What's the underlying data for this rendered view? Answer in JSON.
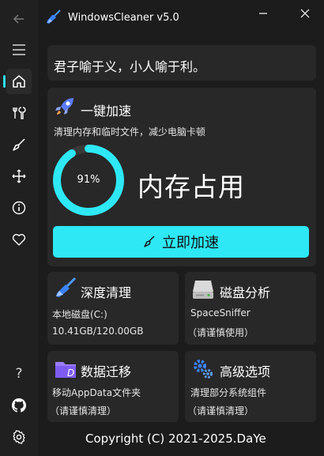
{
  "app": {
    "title": "WindowsCleaner v5.0"
  },
  "sidebar": {
    "items": [
      {
        "name": "back-icon"
      },
      {
        "name": "menu-icon"
      },
      {
        "name": "home-icon",
        "active": true
      },
      {
        "name": "tools-icon"
      },
      {
        "name": "broom-icon"
      },
      {
        "name": "move-icon"
      },
      {
        "name": "info-icon"
      },
      {
        "name": "heart-icon"
      },
      {
        "name": "help-icon",
        "label": "?"
      },
      {
        "name": "github-icon"
      },
      {
        "name": "settings-icon"
      }
    ]
  },
  "quote": {
    "text": "君子喻于义，小人喻于利。"
  },
  "accelerate": {
    "title": "一键加速",
    "subtitle": "清理内存和临时文件，减少电脑卡顿",
    "memory_percent": 91,
    "memory_percent_label": "91%",
    "memory_label": "内存占用",
    "button_label": "立即加速"
  },
  "tiles": {
    "deep_clean": {
      "title": "深度清理",
      "line1": "本地磁盘(C:)",
      "line2": "10.41GB/120.00GB"
    },
    "disk_analysis": {
      "title": "磁盘分析",
      "line1": "SpaceSniffer",
      "line2": "（请谨慎使用）"
    },
    "data_migration": {
      "title": "数据迁移",
      "line1": "移动AppData文件夹",
      "line2": "（请谨慎清理）"
    },
    "advanced": {
      "title": "高级选项",
      "line1": "清理部分系统组件",
      "line2": "（请谨慎清理）"
    }
  },
  "footer": {
    "copyright": "Copyright (C) 2021-2025.DaYe"
  },
  "colors": {
    "accent": "#2ee8f5",
    "background": "#1c1c1c",
    "card": "#282828",
    "sidebar": "#202020"
  }
}
